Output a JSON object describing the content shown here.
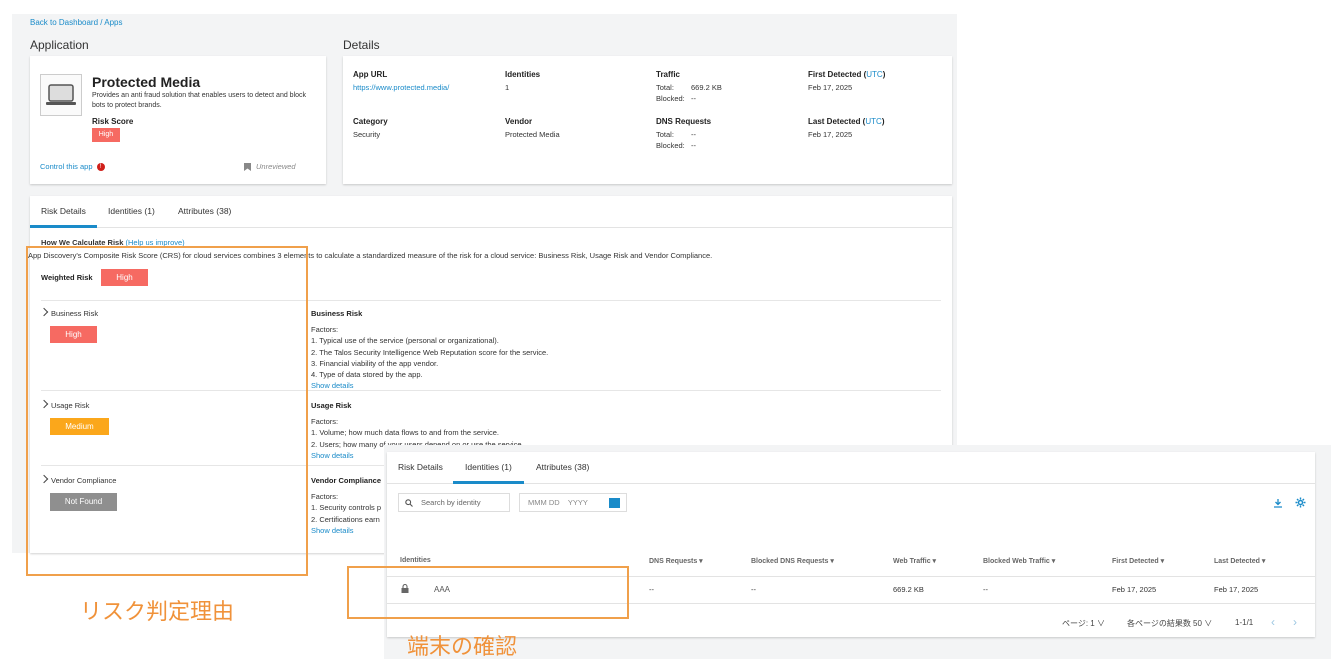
{
  "breadcrumb": "Back to Dashboard / Apps",
  "application": {
    "section_title": "Application",
    "name": "Protected Media",
    "description": "Provides an anti fraud solution that enables users to detect and block bots to protect brands.",
    "risk_score_label": "Risk Score",
    "risk_score": "High",
    "control_link": "Control this app",
    "review_status": "Unreviewed"
  },
  "details": {
    "section_title": "Details",
    "app_url_label": "App URL",
    "app_url": "https://www.protected.media/",
    "identities_label": "Identities",
    "identities": "1",
    "traffic_label": "Traffic",
    "traffic_total_label": "Total:",
    "traffic_total": "669.2 KB",
    "traffic_blocked_label": "Blocked:",
    "traffic_blocked": "--",
    "first_detected_label": "First Detected (",
    "utc": "UTC",
    "close_paren": ")",
    "first_detected": "Feb 17, 2025",
    "category_label": "Category",
    "category": "Security",
    "vendor_label": "Vendor",
    "vendor": "Protected Media",
    "dns_label": "DNS Requests",
    "dns_total_label": "Total:",
    "dns_total": "--",
    "dns_blocked_label": "Blocked:",
    "dns_blocked": "--",
    "last_detected_label": "Last Detected (",
    "last_detected": "Feb 17, 2025"
  },
  "tabs": [
    "Risk Details",
    "Identities (1)",
    "Attributes (38)"
  ],
  "risk": {
    "how_title": "How We Calculate Risk",
    "help_link": "(Help us improve)",
    "description": "App Discovery's Composite Risk Score (CRS) for cloud services combines 3 elements to calculate a standardized measure of the risk for a cloud service: Business Risk, Usage Risk and Vendor Compliance.",
    "weighted_label": "Weighted Risk",
    "weighted_value": "High",
    "business_label": "Business Risk",
    "business_value": "High",
    "usage_label": "Usage Risk",
    "usage_value": "Medium",
    "vendor_label": "Vendor Compliance",
    "vendor_value": "Not Found",
    "business_title": "Business Risk",
    "factors_label": "Factors:",
    "business_factors": [
      "1. Typical use of the service (personal or organizational).",
      "2. The Talos Security Intelligence Web Reputation score for the service.",
      "3. Financial viability of the app vendor.",
      "4. Type of data stored by the app."
    ],
    "show_details": "Show details",
    "usage_title": "Usage Risk",
    "usage_factors": [
      "1. Volume; how much data flows to and from the service.",
      "2. Users; how many of your users depend on or use the service."
    ],
    "vendor_title": "Vendor Compliance",
    "vendor_factors": [
      "1. Security controls p",
      "2. Certifications earn"
    ]
  },
  "identities_panel": {
    "search_placeholder": "Search by identity",
    "date_placeholder": "MMM DD    YYYY",
    "columns": [
      "Identities",
      "DNS Requests",
      "Blocked DNS Requests",
      "Web Traffic",
      "Blocked Web Traffic",
      "First Detected",
      "Last Detected"
    ],
    "row": {
      "identity": "AAA",
      "dns": "--",
      "blocked_dns": "--",
      "web": "669.2 KB",
      "blocked_web": "--",
      "first": "Feb 17, 2025",
      "last": "Feb 17, 2025"
    },
    "page_label": "ページ: 1",
    "per_page_label": "各ページの結果数 50",
    "range": "1-1/1"
  },
  "annotations": {
    "risk_reason": "リスク判定理由",
    "device_check": "端末の確認"
  },
  "colors": {
    "high": "#f66a62",
    "medium": "#fba71b",
    "not_found": "#8f8f8f",
    "link": "#1a8bc9",
    "annotation": "#f0a04b"
  }
}
